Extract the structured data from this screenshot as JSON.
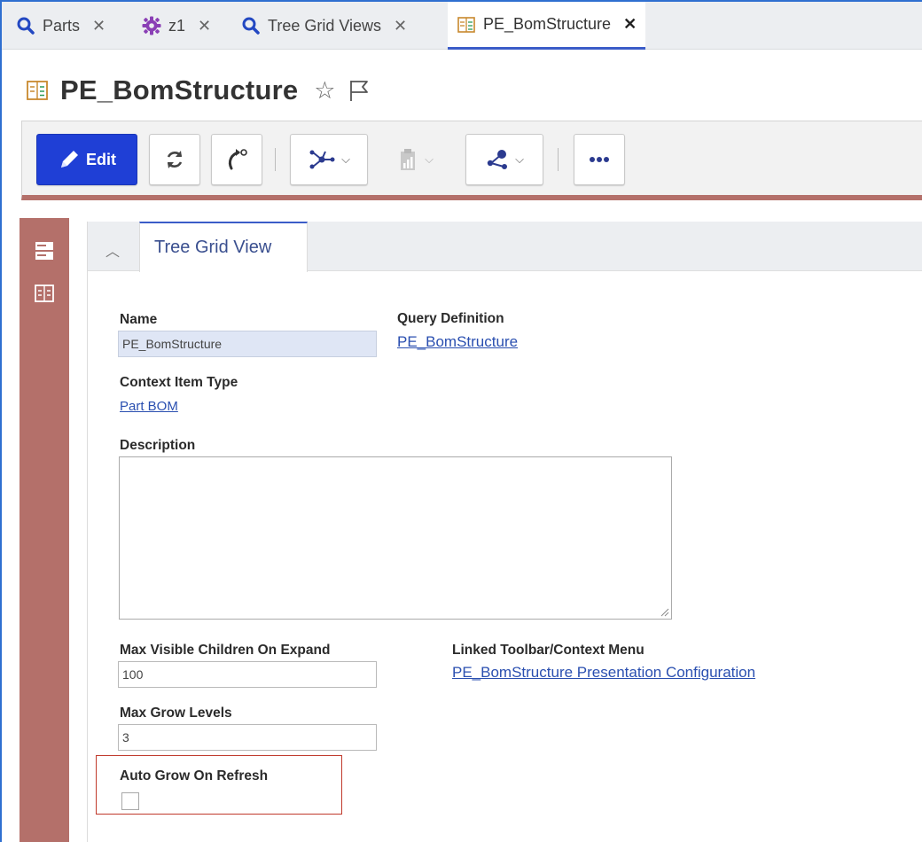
{
  "tabs": [
    {
      "label": "Parts",
      "icon": "search-icon"
    },
    {
      "label": "z1",
      "icon": "gear-icon"
    },
    {
      "label": "Tree Grid Views",
      "icon": "search-icon"
    },
    {
      "label": "PE_BomStructure",
      "icon": "form-icon",
      "active": true
    }
  ],
  "header": {
    "title": "PE_BomStructure"
  },
  "toolbar": {
    "edit_label": "Edit",
    "buttons": [
      "edit-button",
      "refresh-icon",
      "lifecycle-icon",
      "structure-icon",
      "report-icon",
      "share-icon",
      "more-icon"
    ]
  },
  "panel": {
    "tab_label": "Tree Grid View"
  },
  "form": {
    "name_label": "Name",
    "name_value": "PE_BomStructure",
    "query_label": "Query Definition",
    "query_value": "PE_BomStructure",
    "context_label": "Context Item Type",
    "context_value": "Part BOM",
    "description_label": "Description",
    "description_value": "",
    "max_children_label": "Max Visible Children On Expand",
    "max_children_value": "100",
    "linked_label": "Linked Toolbar/Context Menu",
    "linked_value": "PE_BomStructure Presentation Configuration",
    "max_levels_label": "Max Grow Levels",
    "max_levels_value": "3",
    "auto_grow_label": "Auto Grow On Refresh",
    "auto_grow_checked": false
  },
  "colors": {
    "accent_blue": "#1f3fd6",
    "sidebar": "#b4706a",
    "link": "#2a4fb0",
    "highlight": "#c0392b"
  }
}
